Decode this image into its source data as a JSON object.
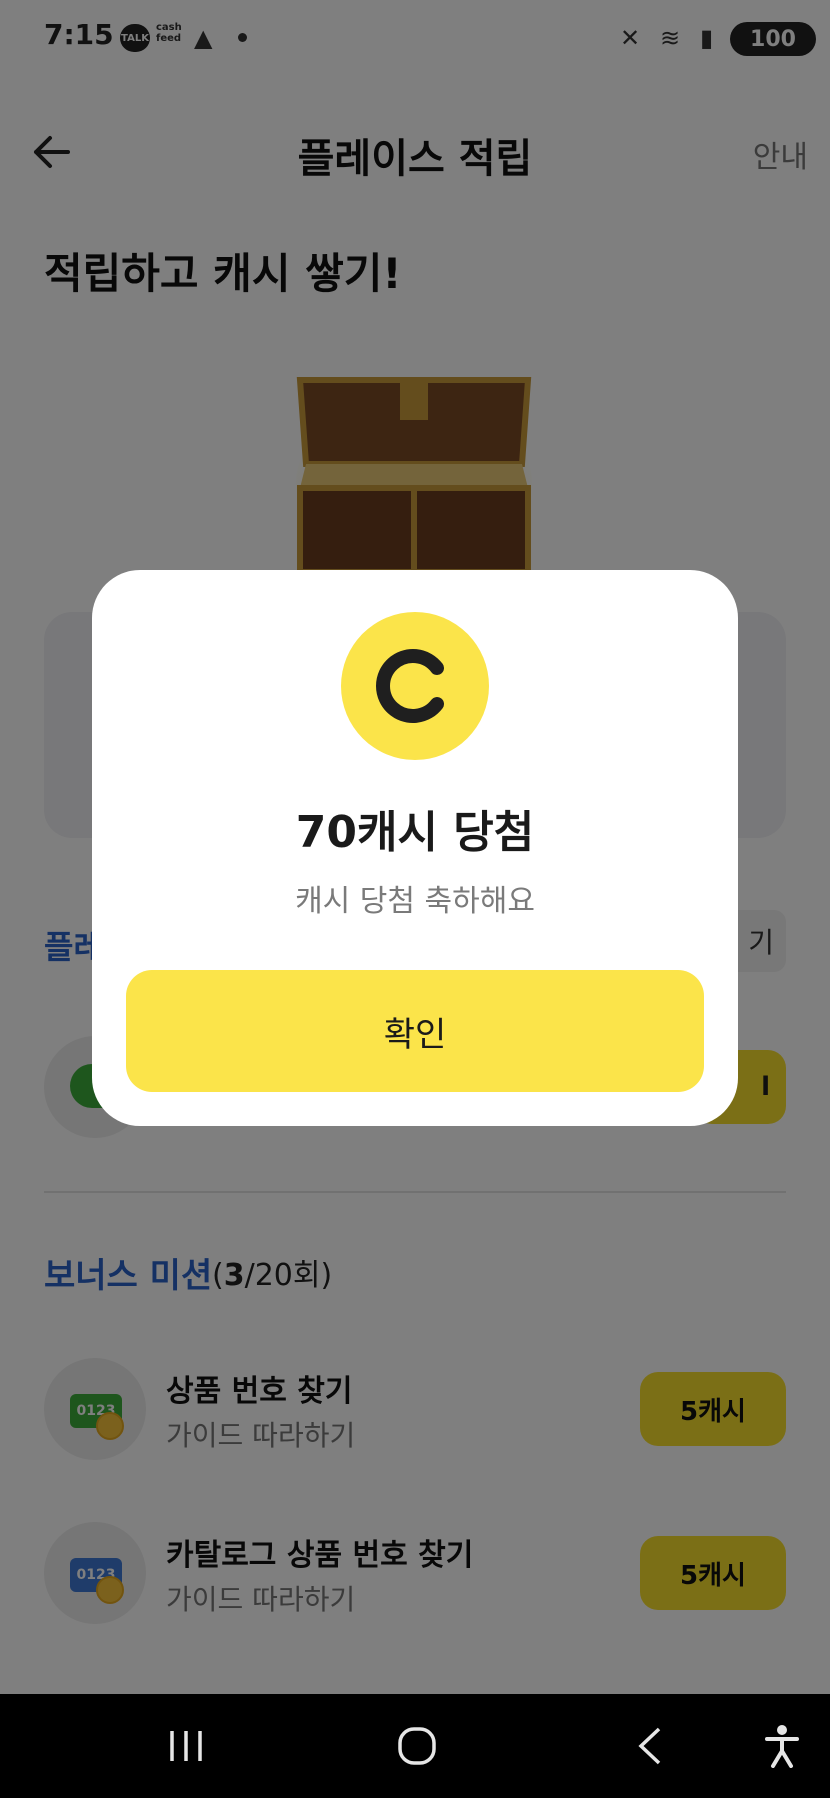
{
  "status_bar": {
    "time": "7:15",
    "chips": [
      "TALK",
      "cash feed"
    ],
    "battery": "100"
  },
  "header": {
    "title": "플레이스 적립",
    "guide_label": "안내"
  },
  "hero": {
    "title": "적립하고 캐시 쌓기!"
  },
  "place_section": {
    "label_partial": "플레",
    "button_partial": "기",
    "action_partial": "l"
  },
  "bonus": {
    "title": "보너스 미션",
    "count_open": "(",
    "count_done": "3",
    "count_rest": "/20회)"
  },
  "missions": [
    {
      "tag": "0123",
      "tag_color": "#3cad3b",
      "title": "상품 번호 찾기",
      "subtitle": "가이드 따라하기",
      "reward": "5캐시"
    },
    {
      "tag": "0123",
      "tag_color": "#3e78d4",
      "title": "카탈로그 상품 번호 찾기",
      "subtitle": "가이드 따라하기",
      "reward": "5캐시"
    }
  ],
  "modal": {
    "coin_letter": "C",
    "title": "70캐시 당첨",
    "subtitle": "캐시 당첨 축하해요",
    "confirm_label": "확인"
  },
  "colors": {
    "accent_yellow": "#fbe44a",
    "section_blue": "#2a63c8"
  }
}
